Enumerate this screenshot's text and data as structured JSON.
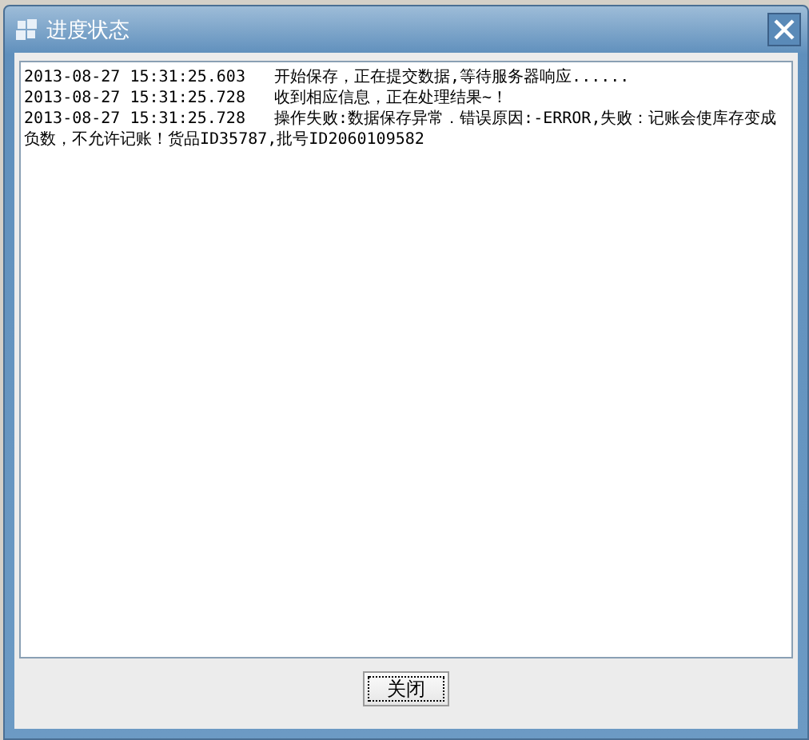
{
  "window": {
    "title": "进度状态"
  },
  "log": [
    {
      "time": "2013-08-27 15:31:25.603",
      "message": "开始保存，正在提交数据,等待服务器响应......"
    },
    {
      "time": "2013-08-27 15:31:25.728",
      "message": "收到相应信息，正在处理结果~！"
    },
    {
      "time": "2013-08-27 15:31:25.728",
      "message": "操作失败:数据保存异常．错误原因:-ERROR,失败：记账会使库存变成负数，不允许记账！货品ID35787,批号ID2060109582"
    }
  ],
  "buttons": [
    "关闭"
  ]
}
